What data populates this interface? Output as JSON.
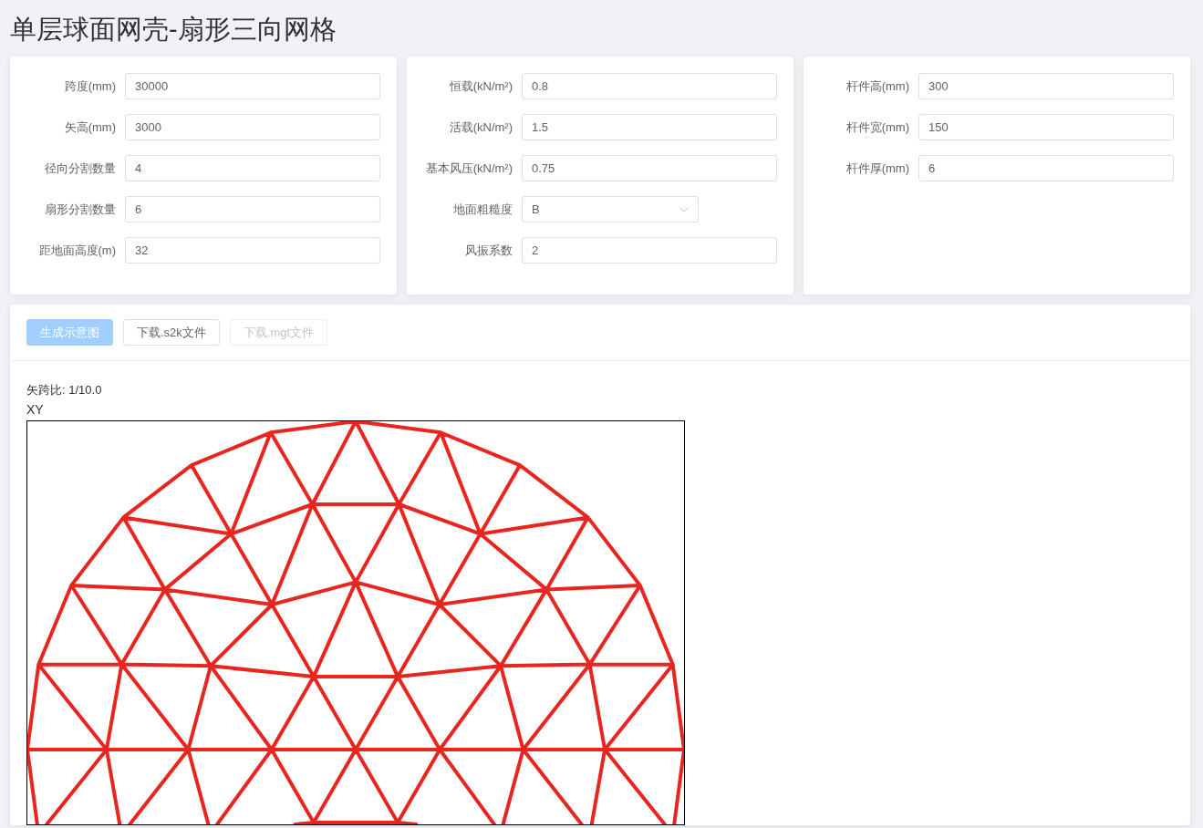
{
  "title": "单层球面网壳-扇形三向网格",
  "form_panels": [
    {
      "fields": [
        {
          "label": "跨度(mm)",
          "kind": "input",
          "value": "30000"
        },
        {
          "label": "矢高(mm)",
          "kind": "input",
          "value": "3000"
        },
        {
          "label": "径向分割数量",
          "kind": "input",
          "value": "4"
        },
        {
          "label": "扇形分割数量",
          "kind": "input",
          "value": "6"
        },
        {
          "label": "距地面高度(m)",
          "kind": "input",
          "value": "32"
        }
      ]
    },
    {
      "fields": [
        {
          "label": "恒载(kN/m²)",
          "kind": "input",
          "value": "0.8"
        },
        {
          "label": "活载(kN/m²)",
          "kind": "input",
          "value": "1.5"
        },
        {
          "label": "基本风压(kN/m²)",
          "kind": "input",
          "value": "0.75"
        },
        {
          "label": "地面粗糙度",
          "kind": "select",
          "value": "B"
        },
        {
          "label": "风振系数",
          "kind": "input",
          "value": "2"
        }
      ]
    },
    {
      "fields": [
        {
          "label": "杆件高(mm)",
          "kind": "input",
          "value": "300"
        },
        {
          "label": "杆件宽(mm)",
          "kind": "input",
          "value": "150"
        },
        {
          "label": "杆件厚(mm)",
          "kind": "input",
          "value": "6"
        }
      ]
    }
  ],
  "buttons": [
    {
      "label": "生成示意图",
      "kind": "primary",
      "disabled": true
    },
    {
      "label": "下载.s2k文件",
      "kind": "default",
      "disabled": false
    },
    {
      "label": "下载.mgt文件",
      "kind": "default",
      "disabled": true
    }
  ],
  "ratio_text": "矢跨比: 1/10.0",
  "view_label": "XY"
}
